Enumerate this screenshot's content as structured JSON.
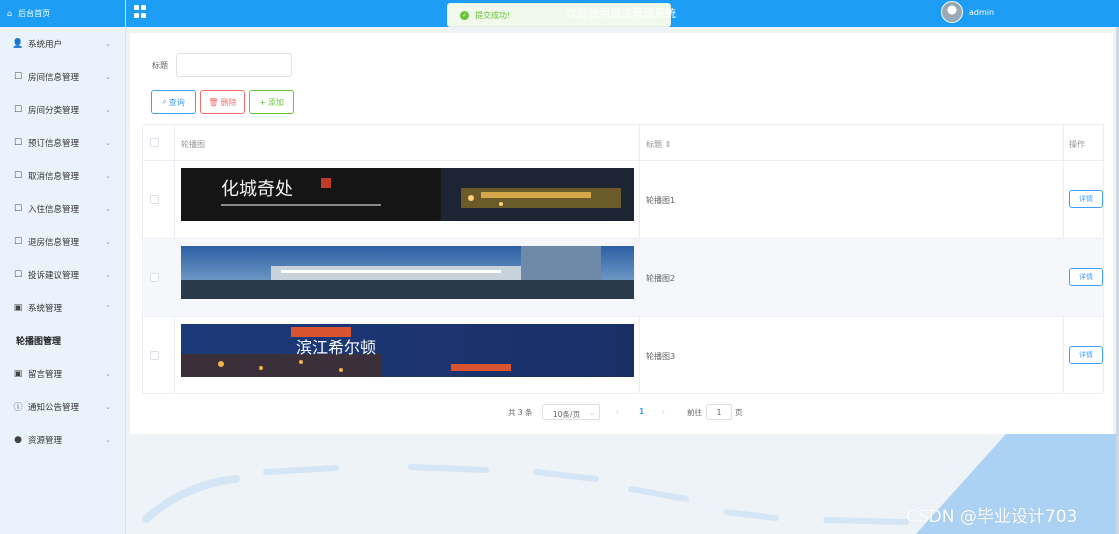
{
  "sidebar": {
    "home": "后台首页",
    "items": [
      {
        "label": "系统用户",
        "icon": "user-icon"
      },
      {
        "label": "房间信息管理",
        "icon": "edit-icon"
      },
      {
        "label": "房间分类管理",
        "icon": "edit-icon"
      },
      {
        "label": "预订信息管理",
        "icon": "edit-icon"
      },
      {
        "label": "取消信息管理",
        "icon": "edit-icon"
      },
      {
        "label": "入住信息管理",
        "icon": "edit-icon"
      },
      {
        "label": "退房信息管理",
        "icon": "edit-icon"
      },
      {
        "label": "投诉建议管理",
        "icon": "edit-icon"
      },
      {
        "label": "系统管理",
        "icon": "picture-icon"
      },
      {
        "label": "轮播图管理",
        "icon": ""
      },
      {
        "label": "留言管理",
        "icon": "picture-icon"
      },
      {
        "label": "通知公告管理",
        "icon": "info-icon"
      },
      {
        "label": "资源管理",
        "icon": "location-icon"
      }
    ]
  },
  "header": {
    "title": "欢迎使用酒店管理系统",
    "user": "admin",
    "toast": "提交成功!"
  },
  "search": {
    "label": "标题",
    "value": "",
    "placeholder": ""
  },
  "toolbar": {
    "query_label": "查询",
    "delete_label": "删除",
    "add_label": "添加"
  },
  "table": {
    "headers": {
      "image": "轮播图",
      "title": "标题",
      "action": "操作"
    },
    "rows": [
      {
        "title": "轮播图1",
        "action": "详情",
        "image_text": "化城奇处"
      },
      {
        "title": "轮播图2",
        "action": "详情",
        "image_text": ""
      },
      {
        "title": "轮播图3",
        "action": "详情",
        "image_text": "滨江希尔顿"
      }
    ]
  },
  "pager": {
    "total": "共 3 条",
    "page_size": "10条/页",
    "current": "1",
    "goto_label": "前往",
    "goto_value": "1",
    "page_suffix": "页"
  },
  "watermark": "CSDN @毕业设计703",
  "colors": {
    "primary": "#1e9df5",
    "danger": "#f56c6c",
    "success": "#67c23a",
    "link": "#409eff"
  }
}
